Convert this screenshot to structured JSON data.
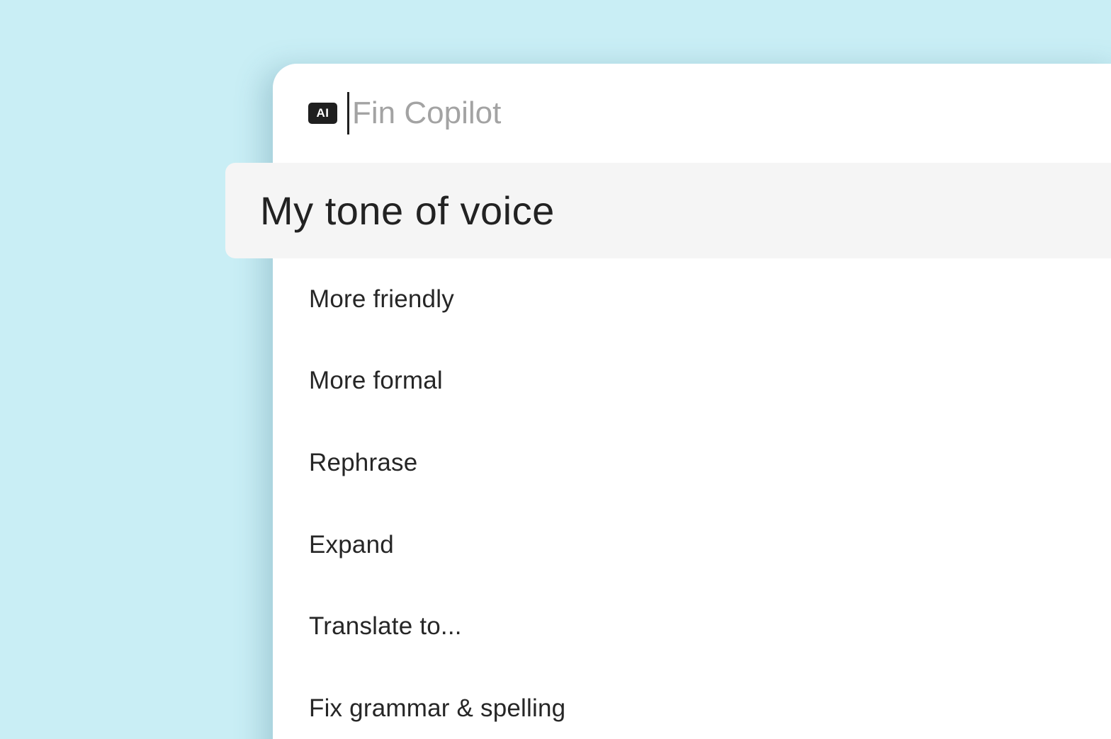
{
  "search": {
    "badge": "AI",
    "placeholder": "Fin Copilot"
  },
  "highlighted": {
    "label": "My tone of voice"
  },
  "menu": {
    "items": [
      {
        "label": "More friendly"
      },
      {
        "label": "More formal"
      },
      {
        "label": "Rephrase"
      },
      {
        "label": "Expand"
      },
      {
        "label": "Translate to..."
      },
      {
        "label": "Fix grammar & spelling"
      }
    ]
  }
}
